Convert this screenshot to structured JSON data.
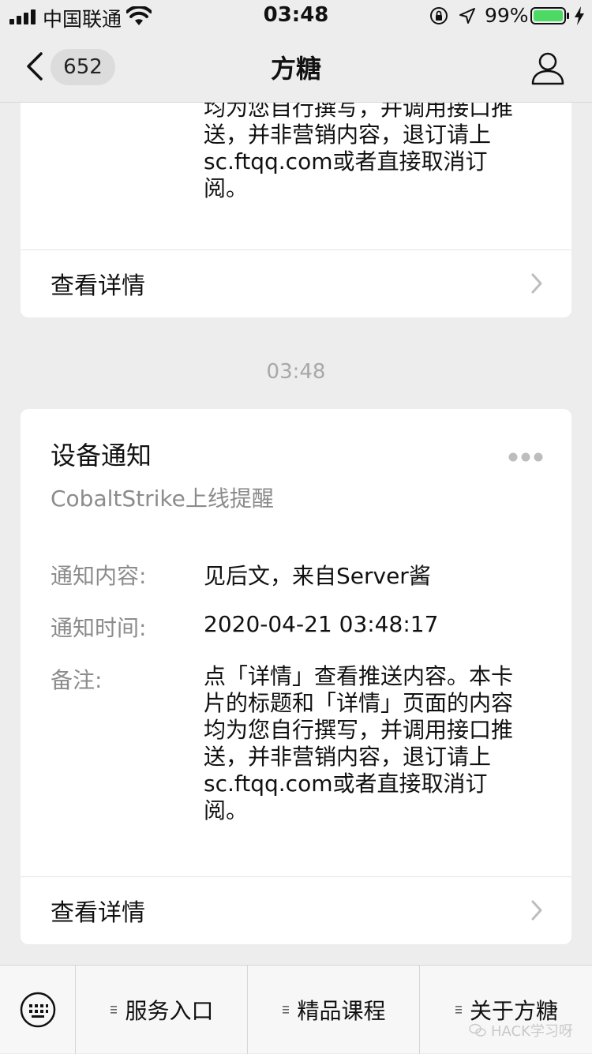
{
  "status": {
    "carrier": "中国联通",
    "time": "03:48",
    "battery_percent": "99%"
  },
  "nav": {
    "unread_count": "652",
    "title": "方糖"
  },
  "messages": {
    "card1": {
      "remark_lines": [
        "均为您自行撰写，并调用接口推",
        "送，并非营销内容，退订请上",
        "sc.ftqq.com或者直接取消订",
        "阅。"
      ],
      "detail_label": "查看详情"
    },
    "time_separator": "03:48",
    "card2": {
      "title": "设备通知",
      "subtitle": "CobaltStrike上线提醒",
      "fields": [
        {
          "label": "通知内容:",
          "value": "见后文，来自Server酱"
        },
        {
          "label": "通知时间:",
          "value": "2020-04-21 03:48:17"
        },
        {
          "label": "备注:",
          "value": ""
        }
      ],
      "remark_lines": [
        "点「详情」查看推送内容。本卡",
        "片的标题和「详情」页面的内容",
        "均为您自行撰写，并调用接口推",
        "送，并非营销内容，退订请上",
        "sc.ftqq.com或者直接取消订",
        "阅。"
      ],
      "detail_label": "查看详情"
    }
  },
  "menu": {
    "items": [
      "服务入口",
      "精品课程",
      "关于方糖"
    ]
  },
  "watermark": "HACK学习呀",
  "colors": {
    "background": "#ededed",
    "card": "#ffffff",
    "muted_text": "#8c8c8c",
    "battery_green": "#4cd964"
  }
}
